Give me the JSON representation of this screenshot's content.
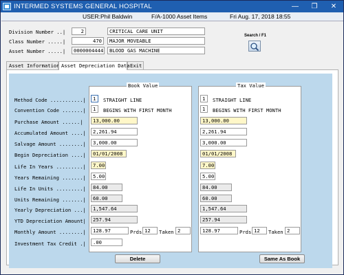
{
  "window": {
    "title": "INTERMED SYSTEMS GENERAL HOSPITAL",
    "minimize": "—",
    "restore": "❐",
    "close": "✕"
  },
  "infobar": {
    "user": "USER:Phil Baldwin",
    "module": "F/A-1000   Asset Items",
    "date": "Fri Aug. 17, 2018 18:55"
  },
  "header": {
    "division_label": "Division Number ..|",
    "division_value": "2",
    "division_desc": "CRITICAL CARE UNIT",
    "class_label": "Class Number .....|",
    "class_value": "470",
    "class_desc": "MAJOR MOVEABLE",
    "asset_label": "Asset Number .....|",
    "asset_value": "0000004444",
    "asset_desc": "BLOOD GAS MACHINE",
    "search_label": "Search / F1"
  },
  "tabs": [
    "Asset Information",
    "Asset Depreciation Data",
    "Exit"
  ],
  "book_title": "Book Value",
  "tax_title": "Tax Value",
  "labels": {
    "method": "Method Code ...........|",
    "convention": "Convention Code .......|",
    "purchase": "Purchase Amount ......|",
    "accumulated": "Accumulated Amount ....|",
    "salvage": "Salvage Amount ........|",
    "begin": "Begin Depreciation ....|",
    "life_years": "Life In Years .........|",
    "years_rem": "Years Remaining .......|",
    "life_units": "Life In Units .........|",
    "units_rem": "Units Remaining .......|",
    "yearly": "Yearly Depreciation ...|",
    "ytd": "YTD Depreciation Amount|",
    "monthly": "Monthly Amount ........|",
    "itc": "Investment Tax Credit .|"
  },
  "book": {
    "method_code": "1",
    "method_desc": "STRAIGHT LINE",
    "conv_code": "1",
    "conv_desc": "BEGINS WITH FIRST MONTH",
    "purchase": "13,000.00",
    "accumulated": "2,261.94",
    "salvage": "3,000.00",
    "begin": "01/01/2008",
    "life_years": "7.00",
    "years_rem": "5.00",
    "life_units": "84.00",
    "units_rem": "60.00",
    "yearly": "1,547.64",
    "ytd": "257.94",
    "monthly": "128.97",
    "prds_label": "Prds",
    "prds": "12",
    "taken_label": "Taken",
    "taken": "2",
    "itc": ".00"
  },
  "tax": {
    "method_code": "1",
    "method_desc": "STRAIGHT LINE",
    "conv_code": "1",
    "conv_desc": "BEGINS WITH FIRST MONTH",
    "purchase": "13,000.00",
    "accumulated": "2,261.94",
    "salvage": "3,000.00",
    "begin": "01/01/2008",
    "life_years": "7.00",
    "years_rem": "5.00",
    "life_units": "84.00",
    "units_rem": "60.00",
    "yearly": "1,547.64",
    "ytd": "257.94",
    "monthly": "128.97",
    "prds_label": "Prds",
    "prds": "12",
    "taken_label": "Taken",
    "taken": "2"
  },
  "buttons": {
    "delete": "Delete",
    "same_as_book": "Same As Book"
  },
  "colors": {
    "titlebar": "#1f5fb0",
    "panel_bg": "#bcd8ec",
    "yellow_field": "#fff7c8"
  }
}
